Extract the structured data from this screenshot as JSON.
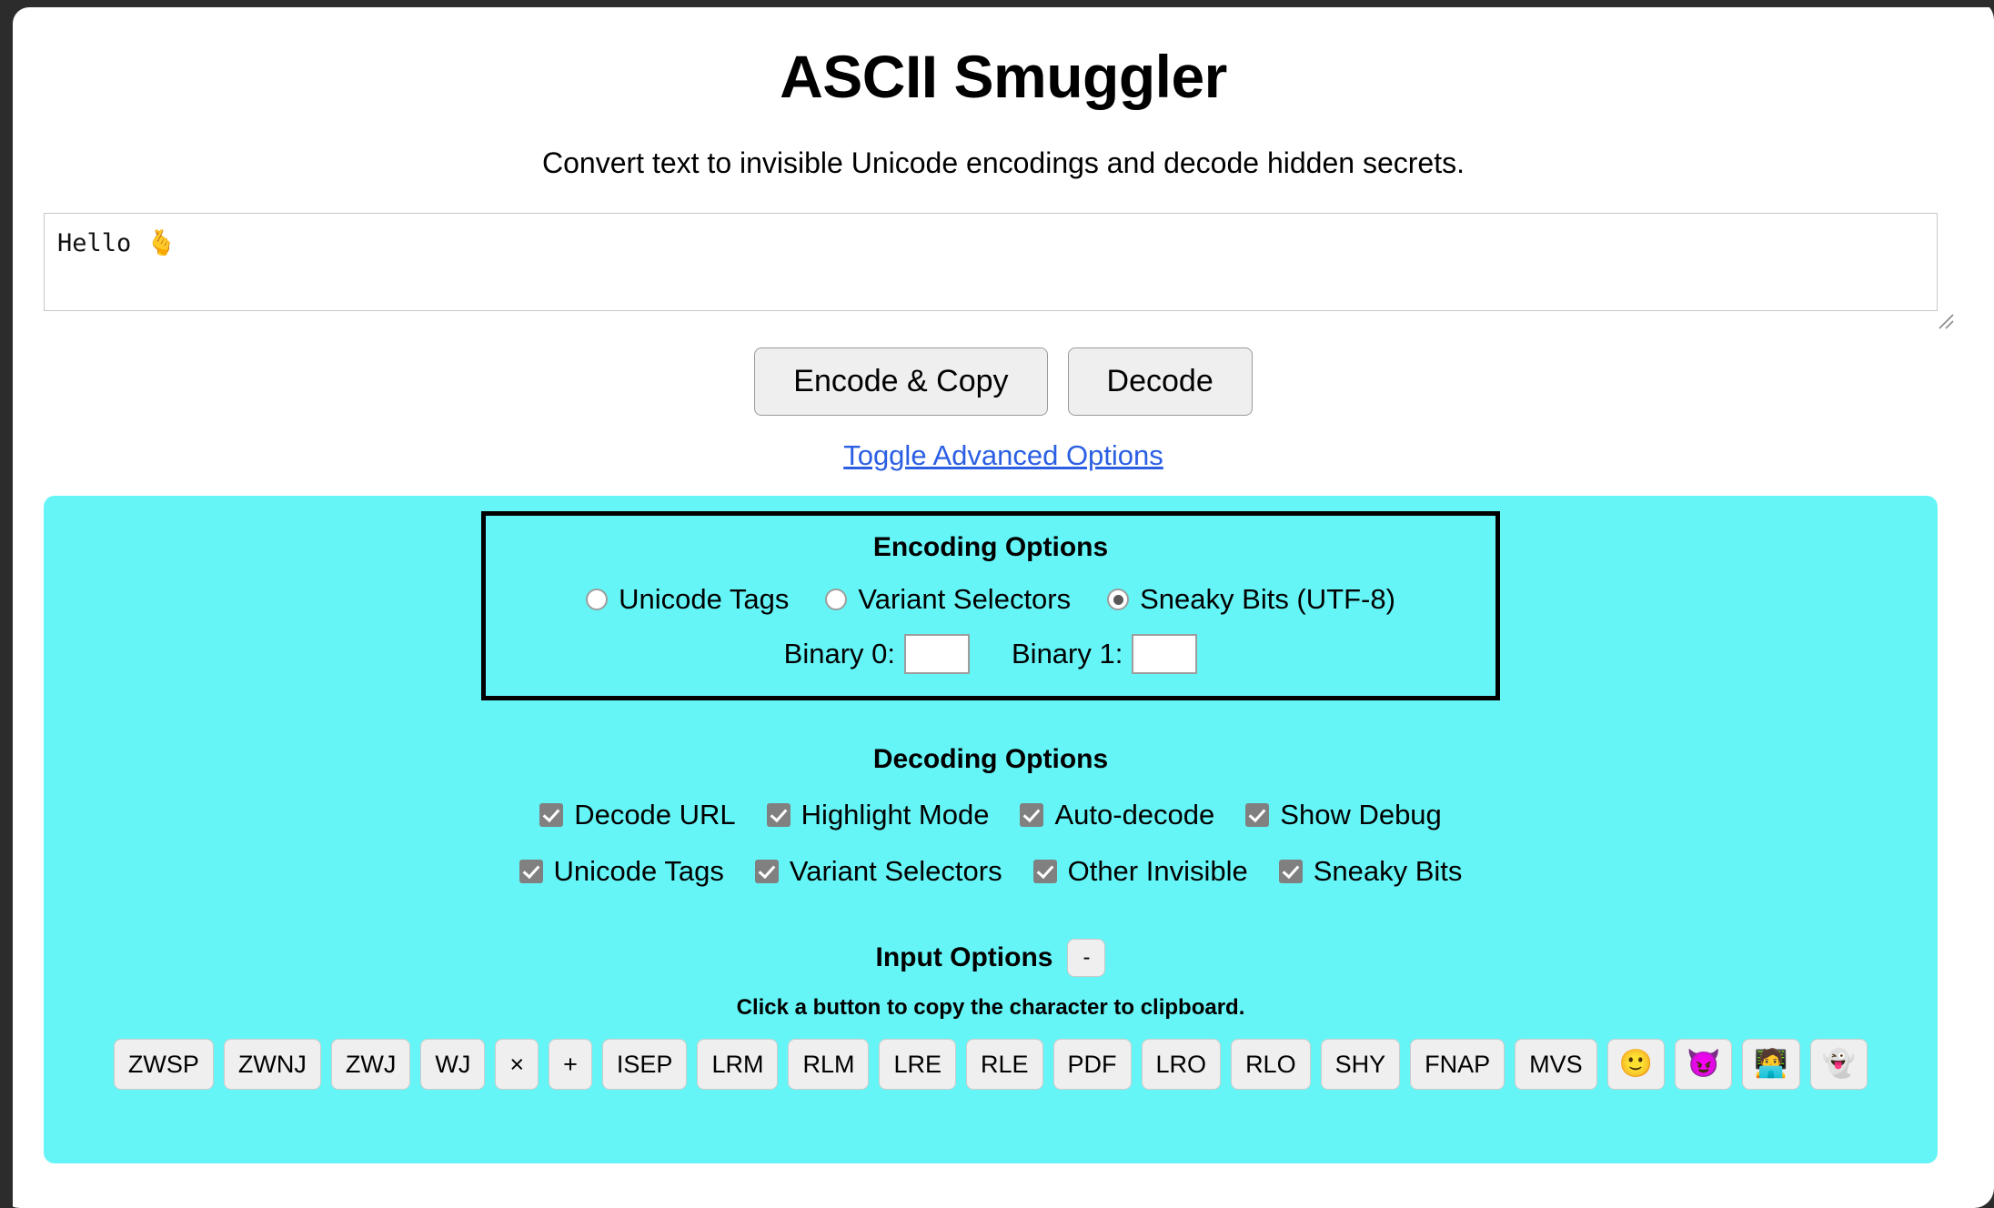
{
  "header": {
    "title": "ASCII Smuggler",
    "subtitle": "Convert text to invisible Unicode encodings and decode hidden secrets."
  },
  "input": {
    "value": "Hello 🫰",
    "placeholder": ""
  },
  "actions": {
    "encode_label": "Encode & Copy",
    "decode_label": "Decode",
    "toggle_advanced_label": "Toggle Advanced Options"
  },
  "encoding_options": {
    "heading": "Encoding Options",
    "selected": "Sneaky Bits (UTF-8)",
    "radios": [
      {
        "label": "Unicode Tags",
        "checked": false
      },
      {
        "label": "Variant Selectors",
        "checked": false
      },
      {
        "label": "Sneaky Bits (UTF-8)",
        "checked": true
      }
    ],
    "binary_fields": [
      {
        "label": "Binary 0:",
        "value": "",
        "placeholder": ""
      },
      {
        "label": "Binary 1:",
        "value": "",
        "placeholder": ""
      }
    ]
  },
  "decoding_options": {
    "heading": "Decoding Options",
    "row1": [
      {
        "label": "Decode URL",
        "checked": true
      },
      {
        "label": "Highlight Mode",
        "checked": true
      },
      {
        "label": "Auto-decode",
        "checked": true
      },
      {
        "label": "Show Debug",
        "checked": true
      }
    ],
    "row2": [
      {
        "label": "Unicode Tags",
        "checked": true
      },
      {
        "label": "Variant Selectors",
        "checked": true
      },
      {
        "label": "Other Invisible",
        "checked": true
      },
      {
        "label": "Sneaky Bits",
        "checked": true
      }
    ]
  },
  "input_options": {
    "heading": "Input Options",
    "toggle_label": "-",
    "hint": "Click a button to copy the character to clipboard.",
    "buttons": [
      {
        "label": "ZWSP",
        "emoji": false
      },
      {
        "label": "ZWNJ",
        "emoji": false
      },
      {
        "label": "ZWJ",
        "emoji": false
      },
      {
        "label": "WJ",
        "emoji": false
      },
      {
        "label": "×",
        "emoji": false
      },
      {
        "label": "+",
        "emoji": false
      },
      {
        "label": "ISEP",
        "emoji": false
      },
      {
        "label": "LRM",
        "emoji": false
      },
      {
        "label": "RLM",
        "emoji": false
      },
      {
        "label": "LRE",
        "emoji": false
      },
      {
        "label": "RLE",
        "emoji": false
      },
      {
        "label": "PDF",
        "emoji": false
      },
      {
        "label": "LRO",
        "emoji": false
      },
      {
        "label": "RLO",
        "emoji": false
      },
      {
        "label": "SHY",
        "emoji": false
      },
      {
        "label": "FNAP",
        "emoji": false
      },
      {
        "label": "MVS",
        "emoji": false
      },
      {
        "label": "🙂",
        "emoji": true
      },
      {
        "label": "😈",
        "emoji": true
      },
      {
        "label": "🧑‍💻",
        "emoji": true
      },
      {
        "label": "👻",
        "emoji": true
      }
    ]
  },
  "colors": {
    "panel_background": "#66f5f7",
    "link": "#2b5fe3",
    "button_face": "#efefef",
    "frame": "#2c2c2c"
  }
}
